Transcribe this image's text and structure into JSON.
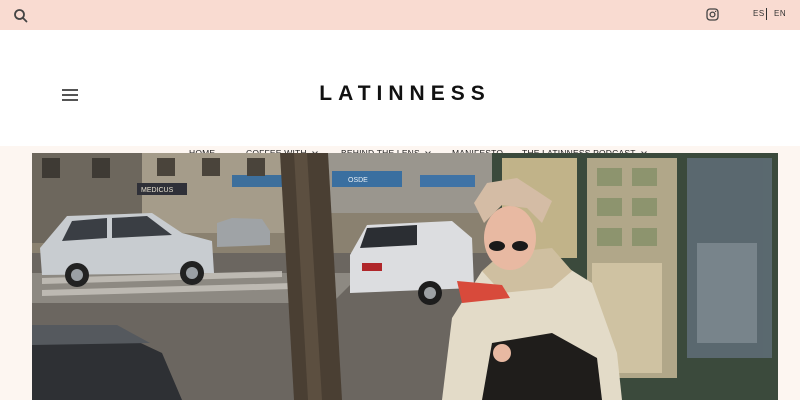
{
  "topbar": {
    "search_icon": "search-icon",
    "instagram_icon": "instagram-icon",
    "languages": [
      "ES",
      "EN"
    ]
  },
  "header": {
    "logo": "LATINNESS",
    "menu_icon": "hamburger-menu-icon"
  },
  "nav": {
    "items": [
      {
        "label": "HOME",
        "dropdown": false
      },
      {
        "label": "COFFEE WITH",
        "dropdown": true
      },
      {
        "label": "BEHIND THE LENS",
        "dropdown": true
      },
      {
        "label": "MANIFESTO",
        "dropdown": false
      },
      {
        "label": "THE LATINNESS PODCAST",
        "dropdown": true
      }
    ]
  },
  "hero": {
    "signs": [
      "MEDICUS",
      "OSDE"
    ]
  },
  "colors": {
    "topbar_bg": "#f9dbd1",
    "page_bg": "#fdf6f1",
    "header_bg": "#ffffff",
    "text": "#222222"
  }
}
